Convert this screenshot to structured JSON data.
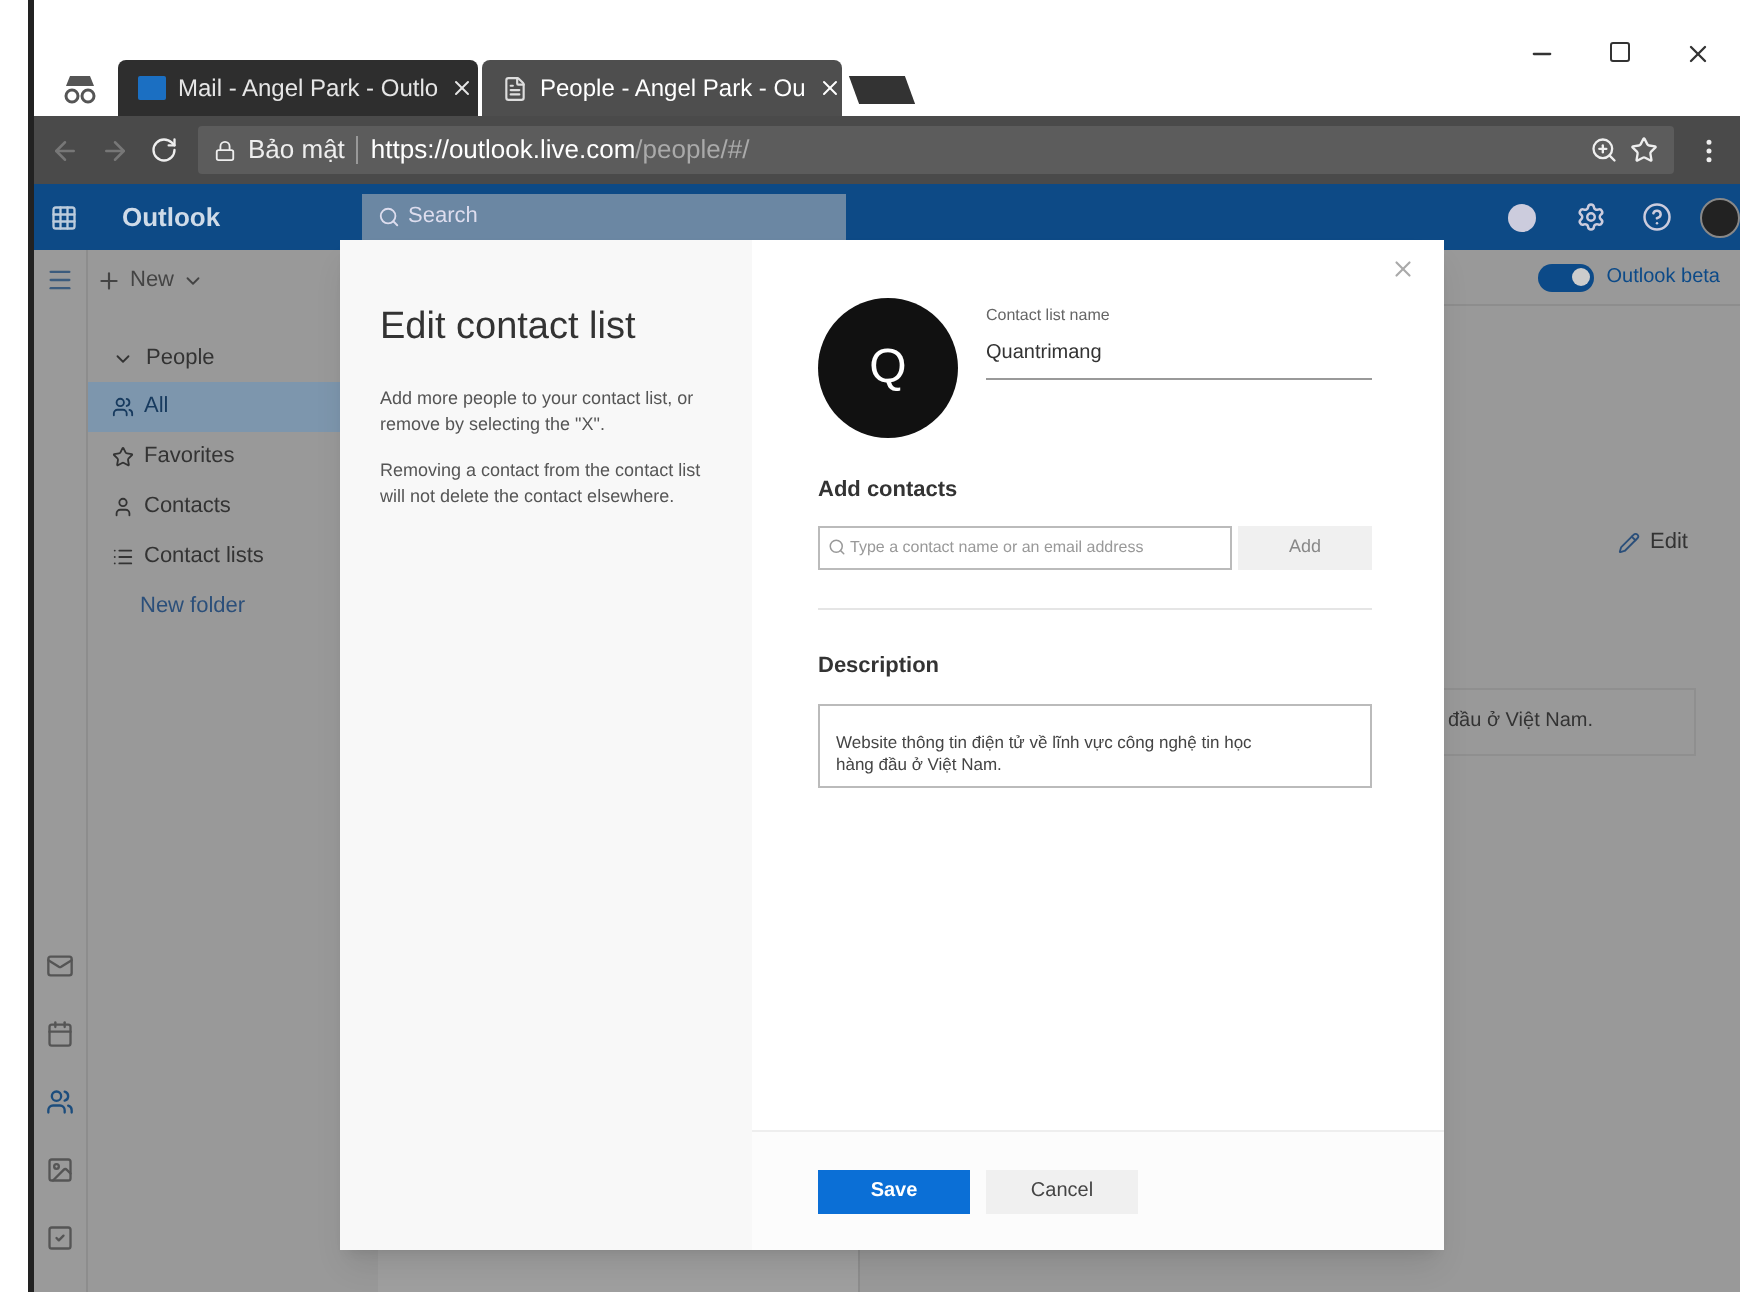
{
  "browser": {
    "tabs": [
      {
        "title": "Mail - Angel Park - Outlo",
        "kind": "mail",
        "selected": false
      },
      {
        "title": "People - Angel Park - Ou",
        "kind": "page",
        "selected": true
      }
    ],
    "secure_label": "Bảo mật",
    "url_host": "https://outlook.live.com",
    "url_path": "/people/#/"
  },
  "app": {
    "name": "Outlook",
    "search_placeholder": "Search",
    "new_label": "New",
    "beta": {
      "label": "Outlook beta",
      "on": true
    }
  },
  "sidebar": {
    "group": {
      "label": "People",
      "expanded": true
    },
    "items": [
      {
        "label": "All",
        "kind": "all",
        "selected": true
      },
      {
        "label": "Favorites",
        "kind": "favorites",
        "selected": false
      },
      {
        "label": "Contacts",
        "kind": "contacts",
        "selected": false
      },
      {
        "label": "Contact lists",
        "kind": "lists",
        "selected": false
      }
    ],
    "new_folder": "New folder"
  },
  "rail": [
    {
      "kind": "mail",
      "selected": false
    },
    {
      "kind": "calendar",
      "selected": false
    },
    {
      "kind": "people",
      "selected": true
    },
    {
      "kind": "photos",
      "selected": false
    },
    {
      "kind": "tasks",
      "selected": false
    }
  ],
  "background": {
    "edit_label": "Edit",
    "description_fragment": "đầu ở Việt Nam."
  },
  "dialog": {
    "title": "Edit contact list",
    "help": [
      "Add more people to your contact list, or remove by selecting the \"X\".",
      "Removing a contact from the contact list will not delete the contact elsewhere."
    ],
    "avatar_initial": "Q",
    "name_label": "Contact list name",
    "name_value": "Quantrimang",
    "add_heading": "Add contacts",
    "add_placeholder": "Type a contact name or an email address",
    "add_button": "Add",
    "description_heading": "Description",
    "description_value": "Website thông tin điện tử về lĩnh vực công nghệ tin học hàng đầu ở Việt Nam.",
    "save": "Save",
    "cancel": "Cancel"
  }
}
